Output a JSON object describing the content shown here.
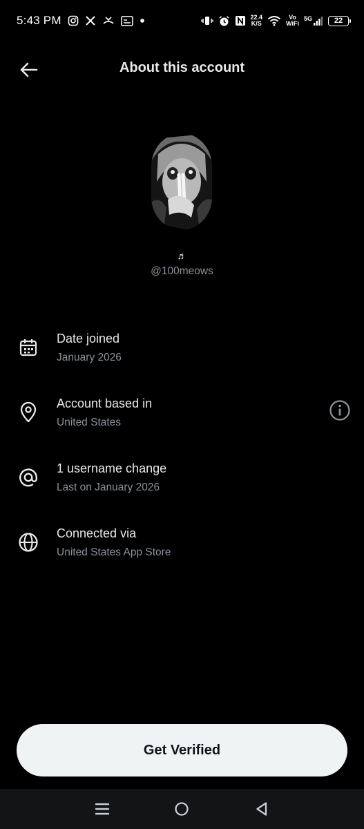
{
  "status_bar": {
    "time": "5:43 PM",
    "left_icons": [
      "instagram-icon",
      "x-icon",
      "missed-call-icon",
      "image-icon",
      "dot-icon"
    ],
    "net_speed_value": "22.4",
    "net_speed_unit": "K/S",
    "vo_label": "Vo",
    "wifi_label": "WiFi",
    "signal_label": "5G",
    "battery": "22"
  },
  "header": {
    "title": "About this account",
    "back_icon": "arrow-left-icon"
  },
  "profile": {
    "display_name": "♬",
    "handle": "@100meows"
  },
  "info": [
    {
      "icon": "calendar-icon",
      "title": "Date joined",
      "subtitle": "January 2026"
    },
    {
      "icon": "location-pin-icon",
      "title": "Account based in",
      "subtitle": "United States"
    },
    {
      "icon": "at-sign-icon",
      "title": "1 username change",
      "subtitle": "Last on January 2026"
    },
    {
      "icon": "globe-icon",
      "title": "Connected via",
      "subtitle": "United States App Store"
    }
  ],
  "cta": {
    "label": "Get Verified"
  },
  "nav": [
    "recents-icon",
    "home-icon",
    "back-icon"
  ],
  "colors": {
    "background": "#000000",
    "primary_text": "#e7e9ea",
    "secondary_text": "#8b9198",
    "button_bg": "#eff3f4",
    "button_text": "#0f1419"
  }
}
